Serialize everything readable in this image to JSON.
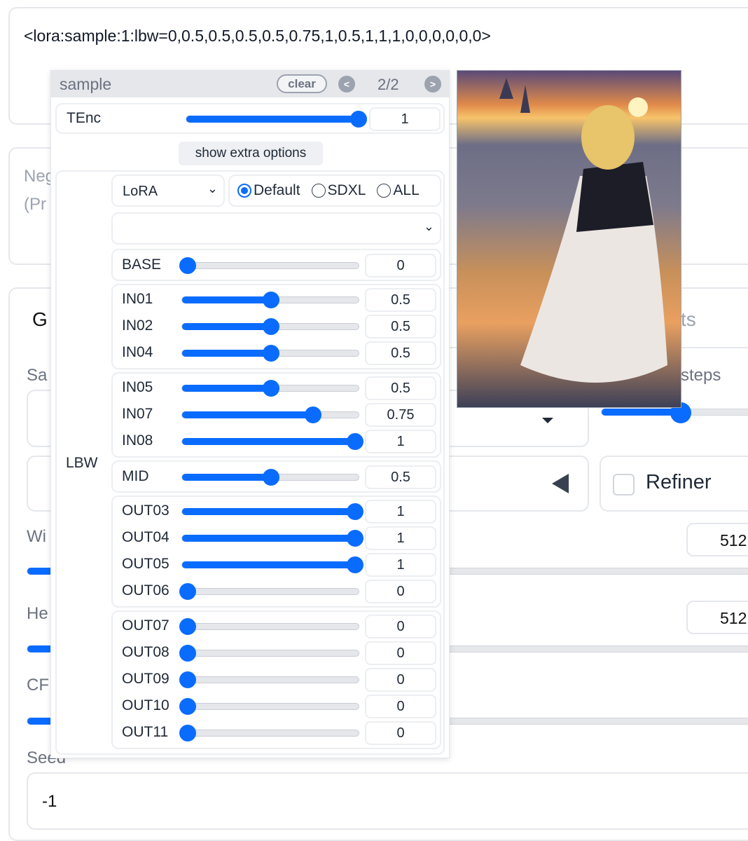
{
  "prompt": "<lora:sample:1:lbw=0,0.5,0.5,0.5,0.5,0.75,1,0.5,1,1,1,0,0,0,0,0,0>",
  "background": {
    "neg_label": "Neg",
    "neg_hint": "(Pr",
    "tab_gen": "G",
    "tab_right": "ts",
    "sampler_label": "Sa",
    "steps_label": "steps",
    "refiner": "Refiner",
    "width_label": "Wi",
    "height_label": "He",
    "cfg_label": "CF",
    "seed_label": "Seed",
    "seed_value": "-1",
    "width_value": "512",
    "height_value": "512"
  },
  "popup": {
    "title": "sample",
    "clear": "clear",
    "prev": "<",
    "next": ">",
    "page": "2/2",
    "tenc": {
      "label": "TEnc",
      "value": "1",
      "fraction": 1
    },
    "extra_button": "show extra options",
    "lbw_label": "LBW",
    "type_select": "LoRA",
    "preset_select": "",
    "radios": [
      {
        "label": "Default",
        "checked": true
      },
      {
        "label": "SDXL",
        "checked": false
      },
      {
        "label": "ALL",
        "checked": false
      }
    ],
    "groups": [
      [
        {
          "label": "BASE",
          "value": "0"
        }
      ],
      [
        {
          "label": "IN01",
          "value": "0.5"
        },
        {
          "label": "IN02",
          "value": "0.5"
        },
        {
          "label": "IN04",
          "value": "0.5"
        }
      ],
      [
        {
          "label": "IN05",
          "value": "0.5"
        },
        {
          "label": "IN07",
          "value": "0.75"
        },
        {
          "label": "IN08",
          "value": "1"
        }
      ],
      [
        {
          "label": "MID",
          "value": "0.5"
        }
      ],
      [
        {
          "label": "OUT03",
          "value": "1"
        },
        {
          "label": "OUT04",
          "value": "1"
        },
        {
          "label": "OUT05",
          "value": "1"
        },
        {
          "label": "OUT06",
          "value": "0"
        }
      ],
      [
        {
          "label": "OUT07",
          "value": "0"
        },
        {
          "label": "OUT08",
          "value": "0"
        },
        {
          "label": "OUT09",
          "value": "0"
        },
        {
          "label": "OUT10",
          "value": "0"
        },
        {
          "label": "OUT11",
          "value": "0"
        }
      ]
    ]
  },
  "colors": {
    "accent": "#0a6cff"
  }
}
